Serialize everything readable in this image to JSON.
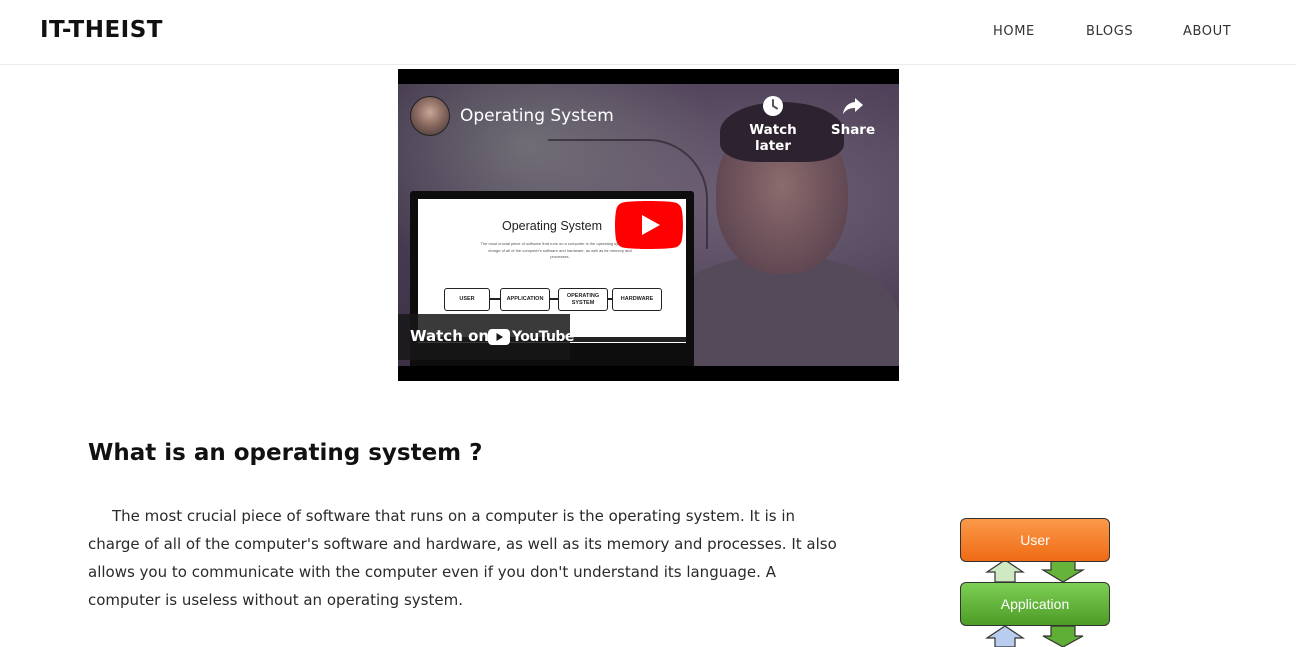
{
  "header": {
    "brand": "IT-THEIST",
    "nav": {
      "home": "HOME",
      "blogs": "BLOGS",
      "about": "ABOUT"
    }
  },
  "video": {
    "title": "Operating System",
    "watch_later": "Watch later",
    "share": "Share",
    "watch_on": "Watch on",
    "youtube": "YouTube",
    "screen": {
      "title": "Operating System",
      "text": "The most crucial piece of software that runs on a computer is the operating system. It is in charge of all of the computer's software and hardware, as well as its memory and processes.",
      "boxes": [
        "USER",
        "APPLICATION",
        "OPERATING SYSTEM",
        "HARDWARE"
      ]
    },
    "colors": {
      "play": "#ff0000",
      "bar": "#171717"
    }
  },
  "article": {
    "heading": "What is an operating system ?",
    "paragraph": "The most crucial piece of software that runs on a computer is the operating system. It is in charge of all of the computer's software and hardware, as well as its memory and processes. It also allows you to communicate with the computer even if you don't understand its language. A computer is useless without an operating system."
  },
  "diagram": {
    "user_label": "User",
    "application_label": "Application",
    "colors": {
      "user": "#ef6a14",
      "application": "#4c9c26",
      "lower_arrow": "#9fb8e0"
    }
  }
}
